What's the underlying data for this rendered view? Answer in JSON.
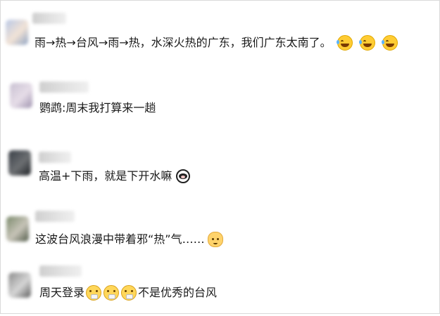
{
  "comments": [
    {
      "text": "雨→热→台风→雨→热，水深火热的广东，我们广东太南了。",
      "emojis": [
        "grinning-tears-icon",
        "grinning-tears-icon",
        "grinning-tears-icon"
      ],
      "avatar_colors": [
        "#b9c8e6",
        "#f2e3d6",
        "#8fa4c4"
      ]
    },
    {
      "text": "鹦鹉:周末我打算来一趟",
      "emojis": [],
      "avatar_colors": [
        "#c9c1d2",
        "#e6dde8",
        "#9e92ae"
      ]
    },
    {
      "text": "高温+下雨，就是下开水嘛",
      "emojis": [
        "cow-face-icon"
      ],
      "avatar_colors": [
        "#3a3f47",
        "#6c6f72",
        "#1f2226"
      ]
    },
    {
      "text": "这波台风浪漫中带着邪“热”气……",
      "emojis": [
        "cat-face-icon"
      ],
      "avatar_colors": [
        "#7b8a6c",
        "#c7c4b8",
        "#505a48"
      ]
    },
    {
      "text": "周天登录",
      "emojis": [
        "masked-face-icon",
        "masked-face-icon",
        "masked-face-icon"
      ],
      "suffix": "不是优秀的台风",
      "avatar_colors": [
        "#8c8c8c",
        "#d6d6d6",
        "#5c5c5c"
      ]
    }
  ]
}
